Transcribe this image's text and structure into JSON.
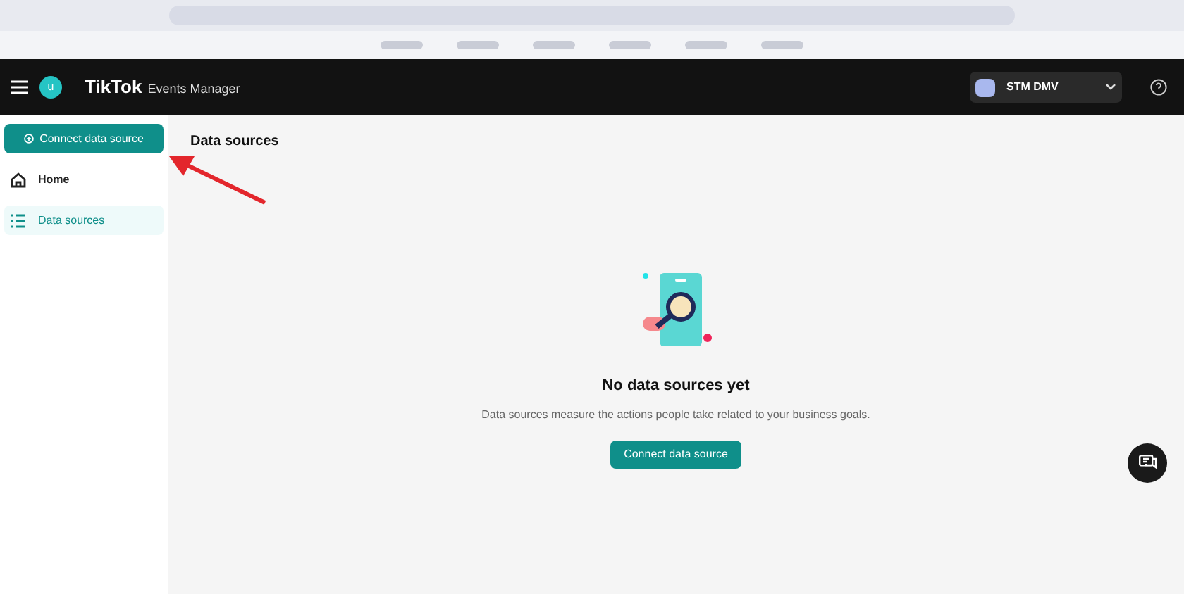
{
  "header": {
    "avatar_letter": "u",
    "logo": "TikTok",
    "product": "Events Manager",
    "account": "STM DMV"
  },
  "sidebar": {
    "connect_button": "Connect data source",
    "items": [
      {
        "label": "Home",
        "kind": "home",
        "selected": false
      },
      {
        "label": "Data sources",
        "kind": "list",
        "selected": true
      }
    ]
  },
  "page": {
    "title": "Data sources",
    "empty_title": "No data sources yet",
    "empty_text": "Data sources measure the actions people take related to your business goals.",
    "button": "Connect data source"
  }
}
